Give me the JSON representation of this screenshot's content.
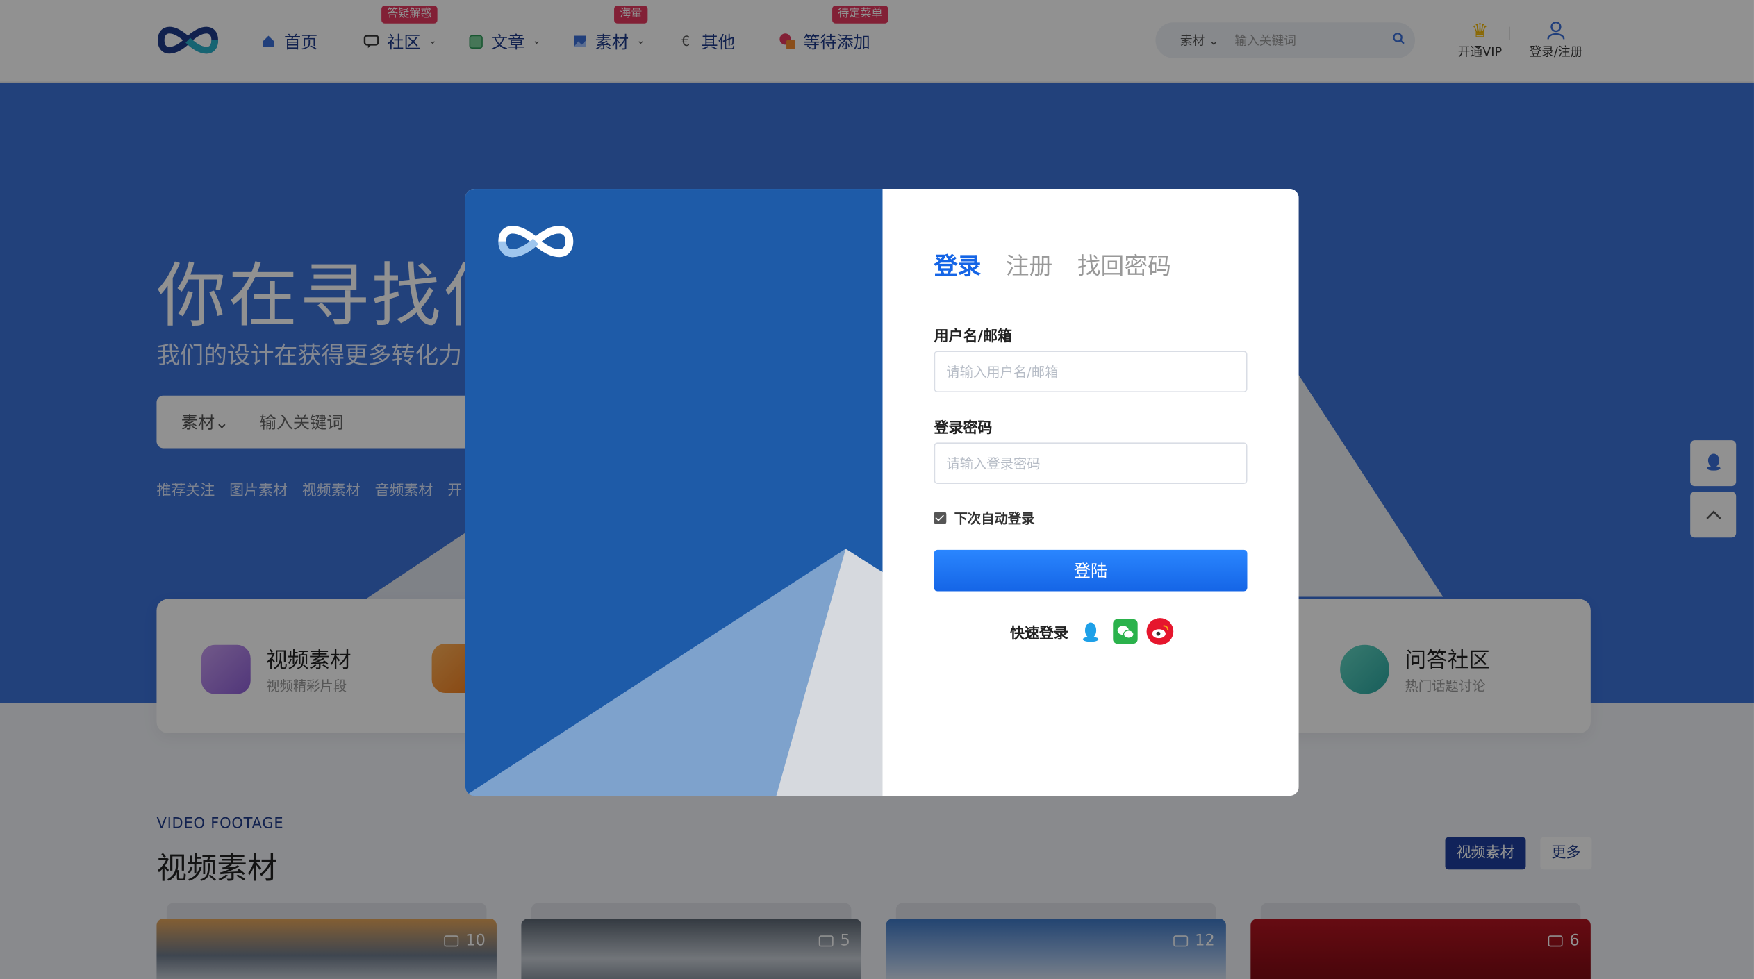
{
  "header": {
    "nav": [
      {
        "label": "首页",
        "badge": ""
      },
      {
        "label": "社区",
        "badge": "答疑解惑"
      },
      {
        "label": "文章",
        "badge": ""
      },
      {
        "label": "素材",
        "badge": "海量"
      },
      {
        "label": "其他",
        "badge": ""
      },
      {
        "label": "等待添加",
        "badge": "待定菜单"
      }
    ],
    "search": {
      "category": "素材",
      "placeholder": "输入关键词"
    },
    "vip_label": "开通VIP",
    "login_label": "登录/注册"
  },
  "hero": {
    "title": "你在寻找什",
    "subtitle": "我们的设计在获得更多转化力",
    "search": {
      "category": "素材",
      "placeholder": "输入关键词"
    },
    "links": [
      "推荐关注",
      "图片素材",
      "视频素材",
      "音频素材",
      "开"
    ]
  },
  "categories": [
    {
      "title": "视频素材",
      "subtitle": "视频精彩片段"
    },
    {
      "title": "问答社区",
      "subtitle": "热门话题讨论"
    }
  ],
  "section": {
    "en_title": "VIDEO FOOTAGE",
    "title": "视频素材",
    "active_button": "视频素材",
    "more_button": "更多",
    "cards": [
      {
        "count": "10"
      },
      {
        "count": "5"
      },
      {
        "count": "12"
      },
      {
        "count": "6"
      }
    ]
  },
  "modal": {
    "tabs": [
      "登录",
      "注册",
      "找回密码"
    ],
    "username_label": "用户名/邮箱",
    "username_placeholder": "请输入用户名/邮箱",
    "password_label": "登录密码",
    "password_placeholder": "请输入登录密码",
    "remember_label": "下次自动登录",
    "submit_label": "登陆",
    "quick_login_label": "快速登录"
  },
  "colors": {
    "brand_blue": "#1565e6",
    "hero_blue": "#3c72d9",
    "badge_red": "#e5395f",
    "modal_left_blue": "#1e5ba8"
  }
}
